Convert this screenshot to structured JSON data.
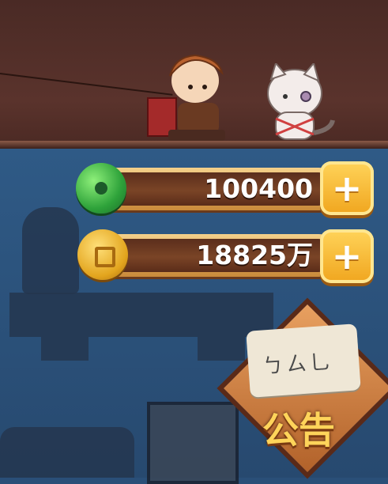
{
  "resources": [
    {
      "id": "green_gem",
      "icon": "green-gem-icon",
      "value": "100400",
      "add_label": "+"
    },
    {
      "id": "gold_coin",
      "icon": "gold-coin-icon",
      "value": "18825万",
      "add_label": "+"
    }
  ],
  "notice": {
    "label": "公告",
    "scribble": "ㄅㄙ乚"
  },
  "colors": {
    "top_band": "#5a332c",
    "background": "#2a4f78",
    "button": "#f0a51e",
    "gem": "#2ea23a",
    "coin": "#e3a51e",
    "notice_text": "#ffd45a"
  }
}
